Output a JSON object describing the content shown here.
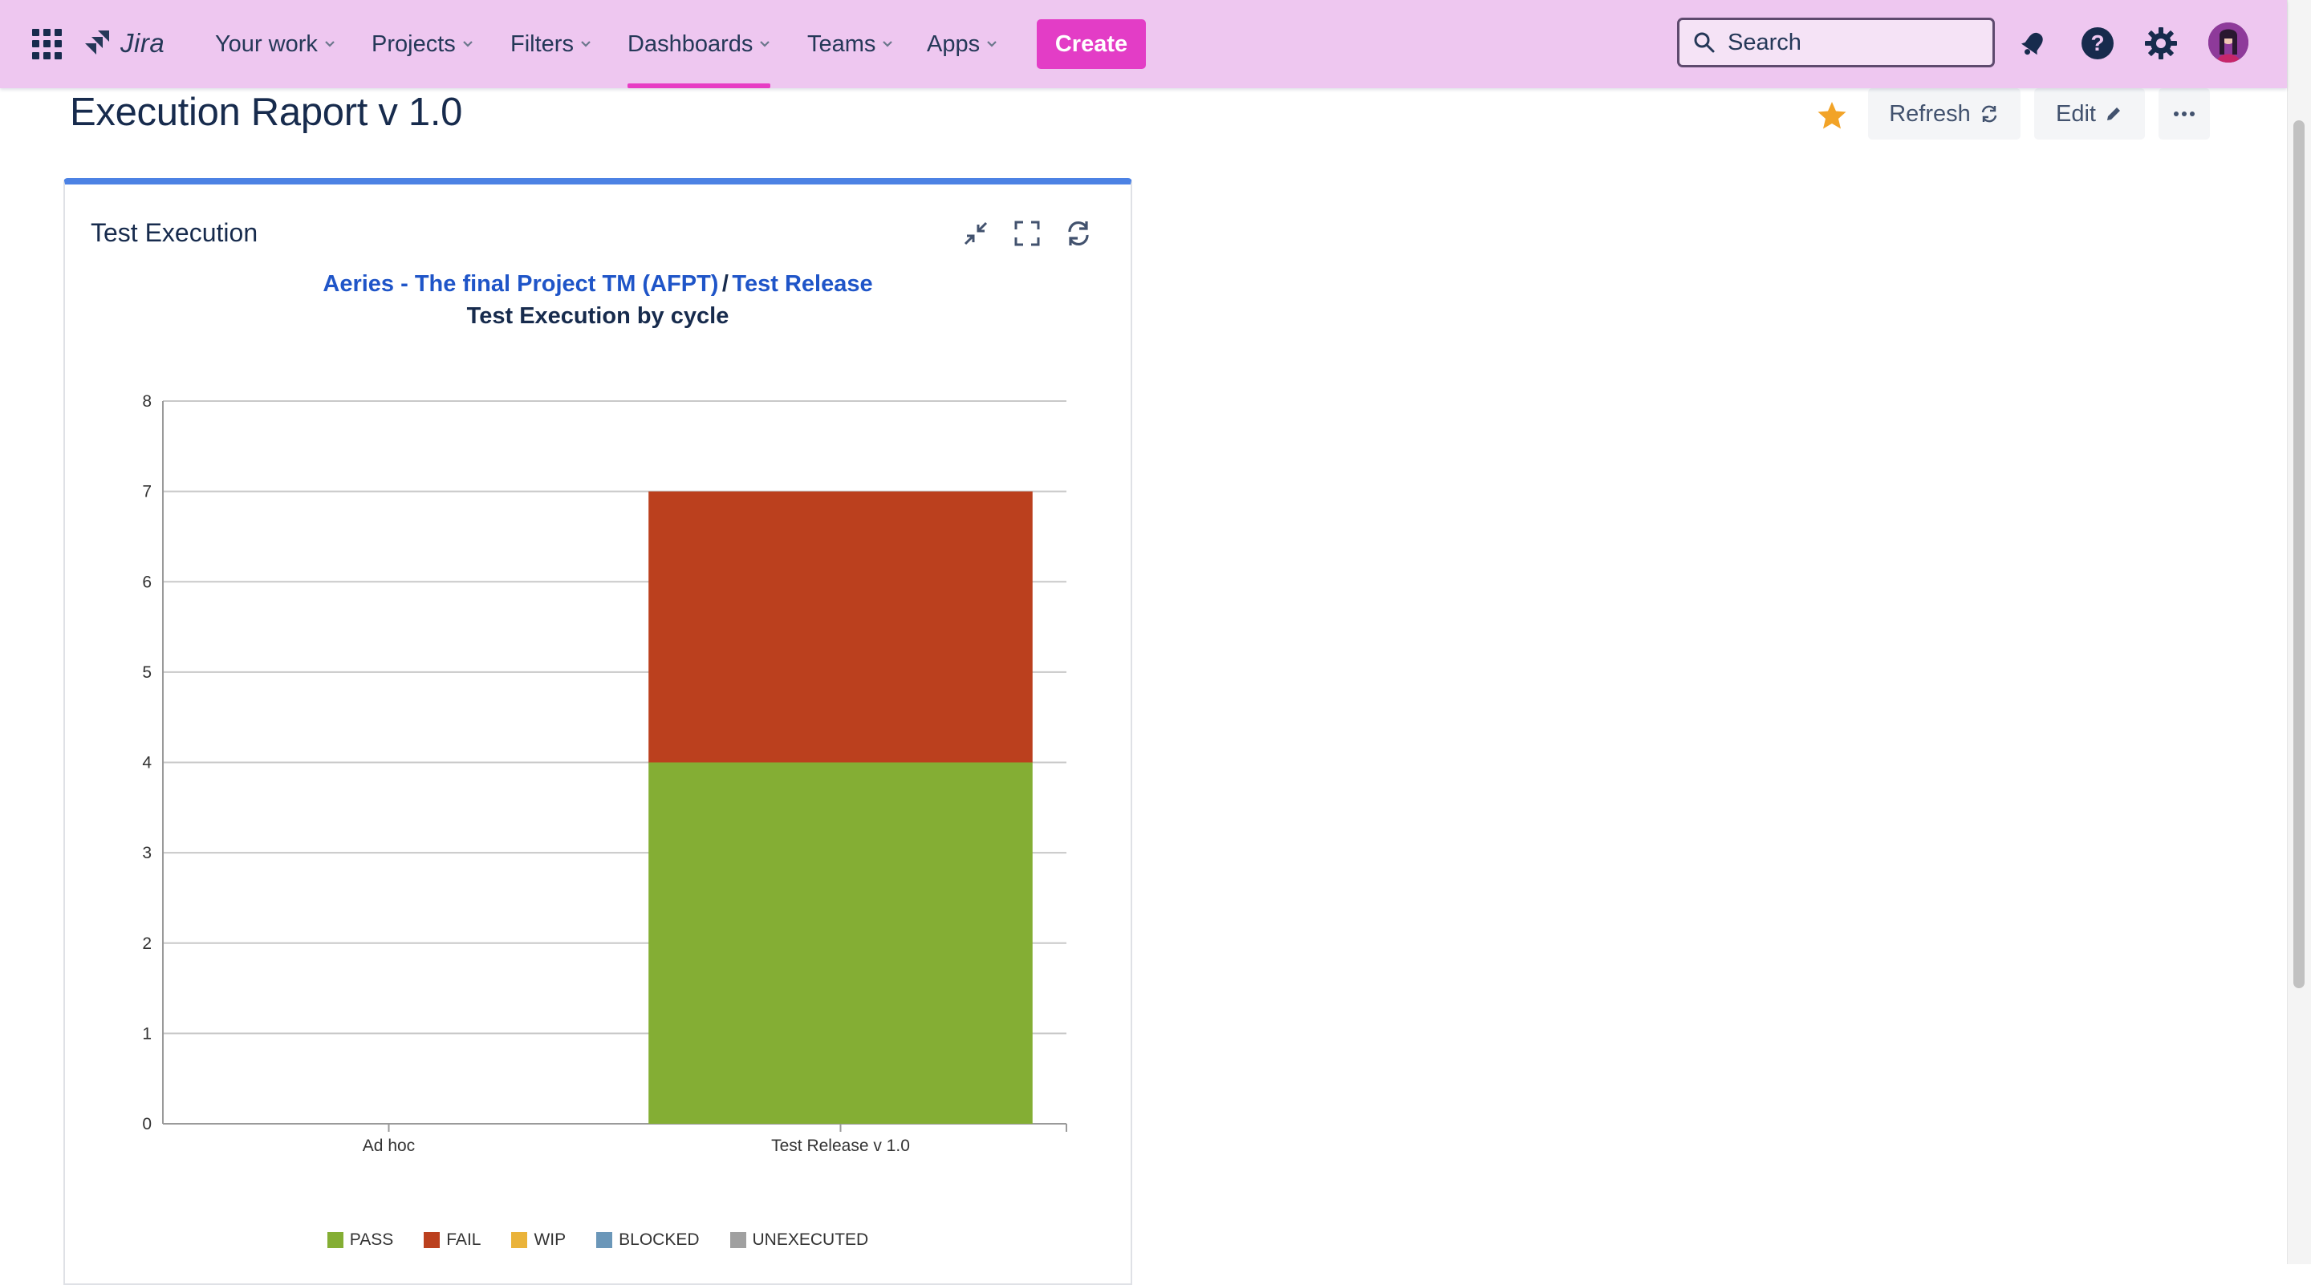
{
  "nav": {
    "logo": "Jira",
    "items": [
      {
        "label": "Your work"
      },
      {
        "label": "Projects"
      },
      {
        "label": "Filters"
      },
      {
        "label": "Dashboards"
      },
      {
        "label": "Teams"
      },
      {
        "label": "Apps"
      }
    ],
    "create_label": "Create",
    "search_placeholder": "Search"
  },
  "page": {
    "title": "Execution Raport v 1.0",
    "refresh_label": "Refresh",
    "edit_label": "Edit"
  },
  "gadget": {
    "title": "Test Execution",
    "project_link": "Aeries - The final Project TM (AFPT)",
    "separator": "/",
    "release_link": "Test Release",
    "subtitle": "Test Execution by cycle"
  },
  "chart_data": {
    "type": "bar",
    "stacked": true,
    "title": "Test Execution by cycle",
    "xlabel": "",
    "ylabel": "",
    "categories": [
      "Ad hoc",
      "Test Release v 1.0"
    ],
    "ylim": [
      0,
      8
    ],
    "yticks": [
      0,
      1,
      2,
      3,
      4,
      5,
      6,
      7,
      8
    ],
    "grid": true,
    "legend_position": "bottom",
    "series": [
      {
        "name": "PASS",
        "color": "#84ae34",
        "values": [
          0,
          4
        ]
      },
      {
        "name": "FAIL",
        "color": "#bb401e",
        "values": [
          0,
          3
        ]
      },
      {
        "name": "WIP",
        "color": "#eab33a",
        "values": [
          0,
          0
        ]
      },
      {
        "name": "BLOCKED",
        "color": "#6b97b9",
        "values": [
          0,
          0
        ]
      },
      {
        "name": "UNEXECUTED",
        "color": "#a0a0a0",
        "values": [
          0,
          0
        ]
      }
    ]
  },
  "colors": {
    "nav_bg": "#eec7f0",
    "create_bg": "#e33dc6",
    "gadget_accent": "#4c82e4",
    "star": "#f2a327",
    "link": "#1f55c8"
  }
}
